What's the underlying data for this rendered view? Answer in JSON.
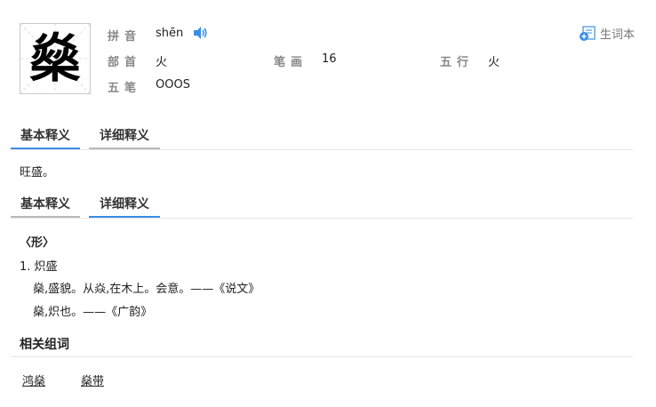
{
  "header": {
    "character": "燊",
    "pinyin_label": "拼音",
    "pinyin_value": "shēn",
    "radical_label": "部首",
    "radical_value": "火",
    "strokes_label": "笔画",
    "strokes_value": "16",
    "wuxing_label": "五行",
    "wuxing_value": "火",
    "wubi_label": "五笔",
    "wubi_value": "OOOS",
    "wordbook_label": "生词本"
  },
  "tabs_top": [
    {
      "label": "基本释义",
      "active": true
    },
    {
      "label": "详细释义",
      "active": false
    }
  ],
  "basic_definition": "旺盛。",
  "tabs_bottom": [
    {
      "label": "基本释义",
      "active": false
    },
    {
      "label": "详细释义",
      "active": true
    }
  ],
  "detailed": {
    "pos": "〈形〉",
    "sense1": "1. 炽盛",
    "quote1": "燊,盛貌。从焱,在木上。会意。——《说文》",
    "quote2": "燊,炽也。——《广韵》"
  },
  "related": {
    "title": "相关组词",
    "words": [
      "鸿燊",
      "燊带"
    ]
  },
  "colors": {
    "accent": "#3a8ee6",
    "tab_inactive": "#b8b8b8",
    "speaker": "#3a8ee6"
  },
  "icons": [
    "speaker-icon",
    "add-wordbook-icon"
  ]
}
